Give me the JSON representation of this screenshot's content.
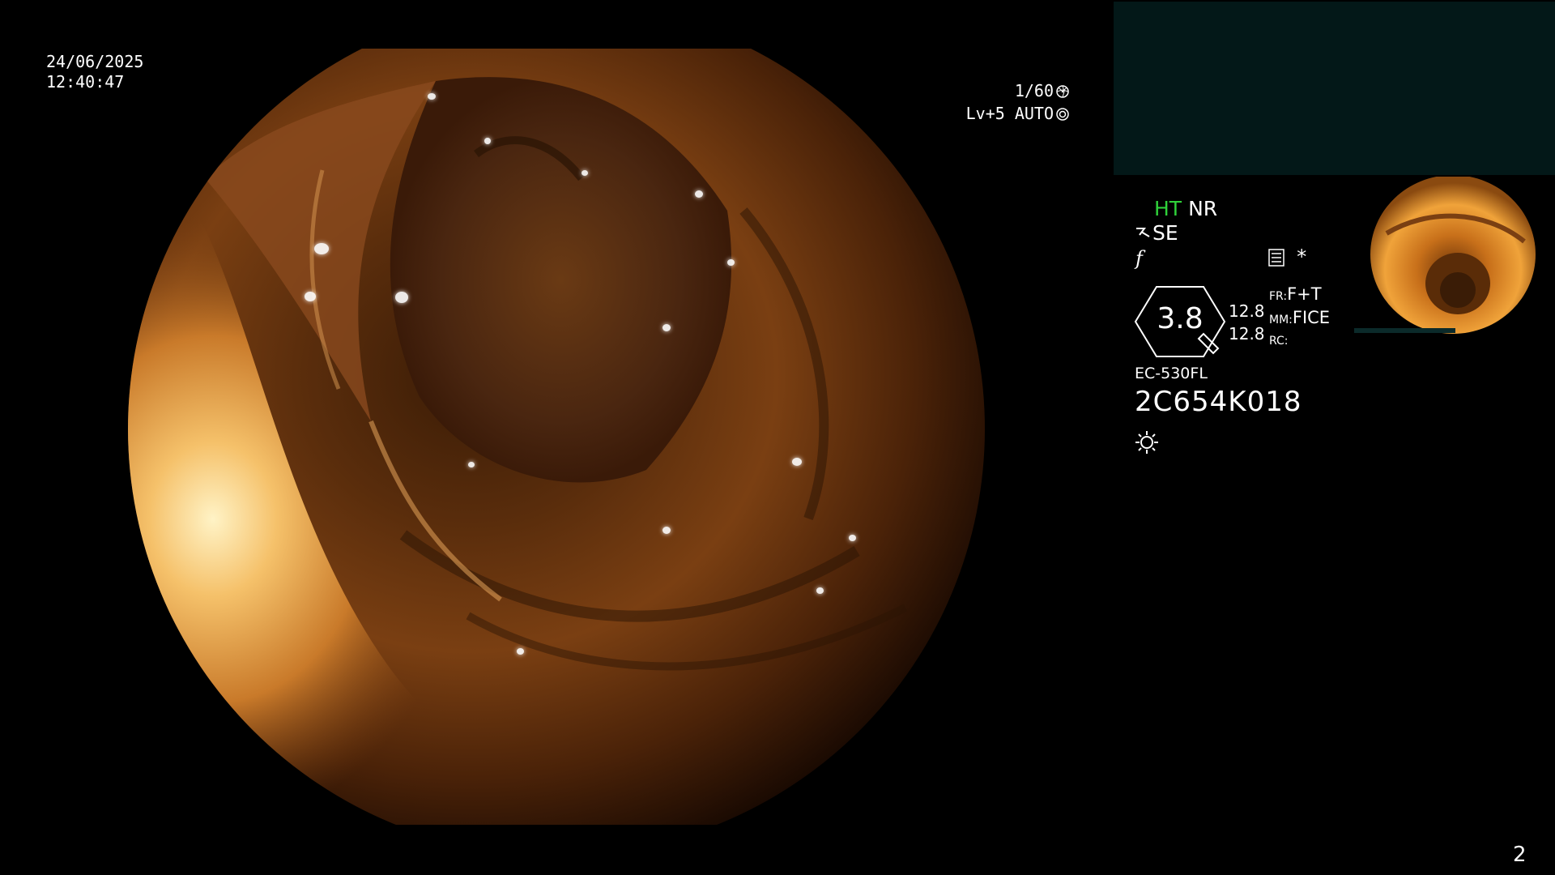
{
  "header": {
    "date": "24/06/2025",
    "time": "12:40:47"
  },
  "exposure": {
    "shutter": "1/60",
    "level": "Lv+5",
    "mode": "AUTO"
  },
  "panel": {
    "mode_ht": "HT",
    "mode_nr": "NR",
    "se": "SE",
    "f_symbol": "f",
    "asterisk": "*",
    "zoom": "3.8",
    "value_1": "12.8",
    "value_2": "12.8",
    "fr_label": "FR:",
    "fr_value": "F+T",
    "mm_label": "MM:",
    "mm_value": "FICE",
    "rc_label": "RC:",
    "scope_model": "EC-530FL",
    "serial": "2C654K018"
  },
  "page_number": "2",
  "icons": [
    "aperture-icon",
    "iris-icon",
    "se-icon",
    "menu-list-icon",
    "light-icon"
  ],
  "colors": {
    "ht_green": "#2fd13a",
    "teal_box": "#031818"
  }
}
